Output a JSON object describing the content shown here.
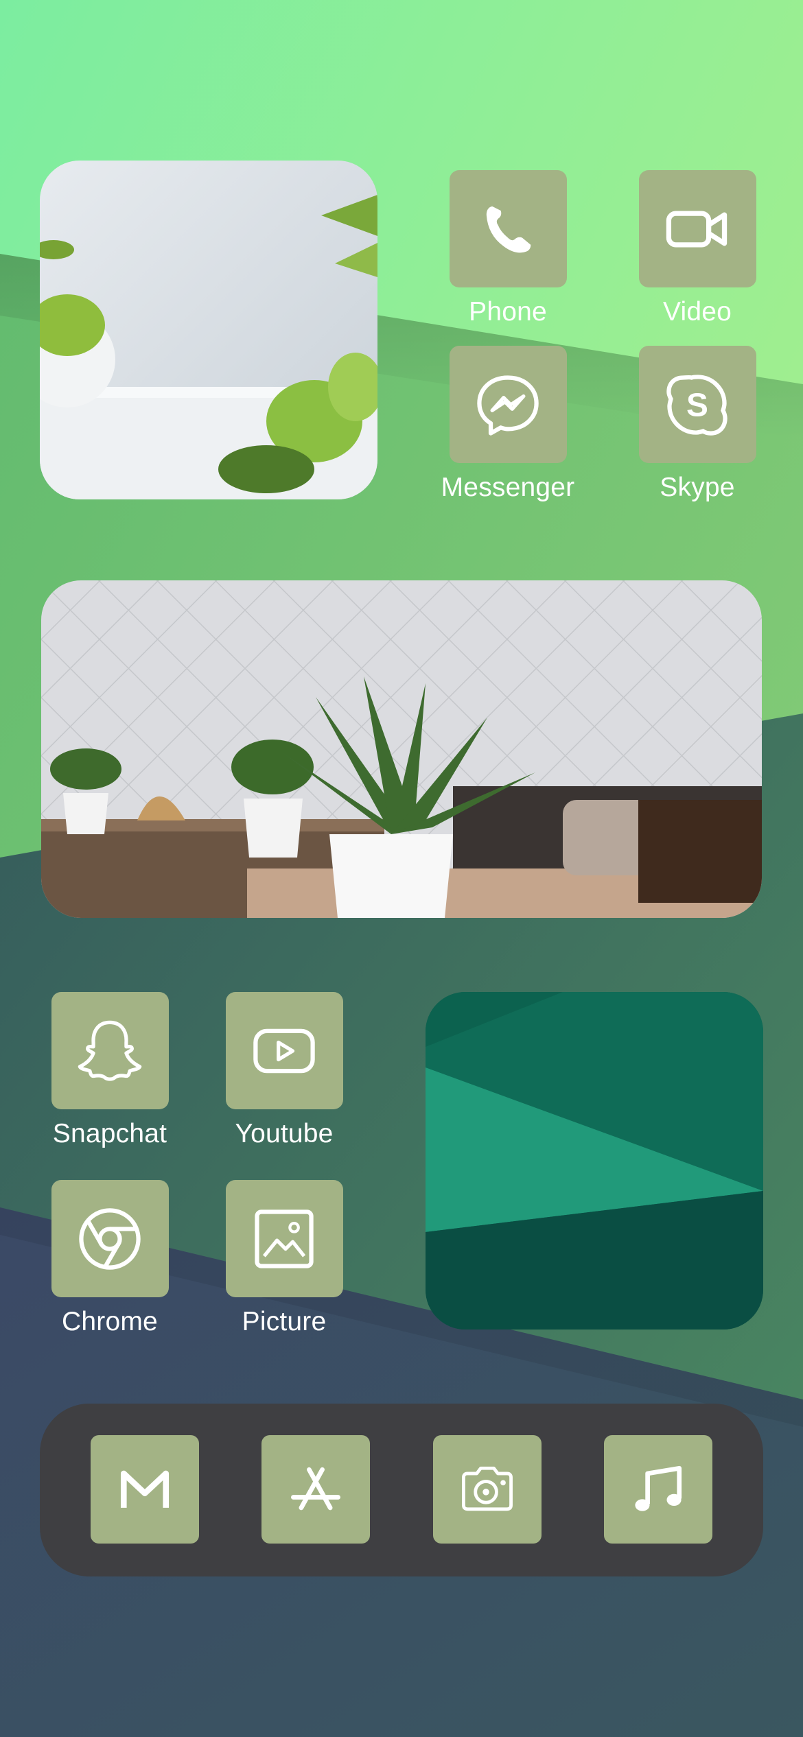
{
  "wallpaper": {
    "colors": {
      "top_green": "#9ff08f",
      "mid_green": "#74c774",
      "teal": "#3d6f62",
      "navy": "#394a6a"
    }
  },
  "apps": [
    {
      "label": "Phone",
      "icon": "phone-icon"
    },
    {
      "label": "Video",
      "icon": "video-camera-icon"
    },
    {
      "label": "Messenger",
      "icon": "messenger-icon"
    },
    {
      "label": "Skype",
      "icon": "skype-icon"
    },
    {
      "label": "Snapchat",
      "icon": "snapchat-ghost-icon"
    },
    {
      "label": "Youtube",
      "icon": "youtube-play-icon"
    },
    {
      "label": "Chrome",
      "icon": "chrome-icon"
    },
    {
      "label": "Picture",
      "icon": "picture-icon"
    }
  ],
  "dock": {
    "items": [
      {
        "icon": "gmail-icon"
      },
      {
        "icon": "app-store-icon"
      },
      {
        "icon": "camera-icon"
      },
      {
        "icon": "music-note-icon"
      }
    ],
    "background": "#3f3f42"
  },
  "widgets": {
    "top_left": {
      "content": "photo-widget-plants-white-wall"
    },
    "middle": {
      "content": "photo-widget-plant-on-table"
    },
    "right": {
      "content": "photo-widget-green-paper"
    }
  },
  "tile_color": "#a3b385"
}
